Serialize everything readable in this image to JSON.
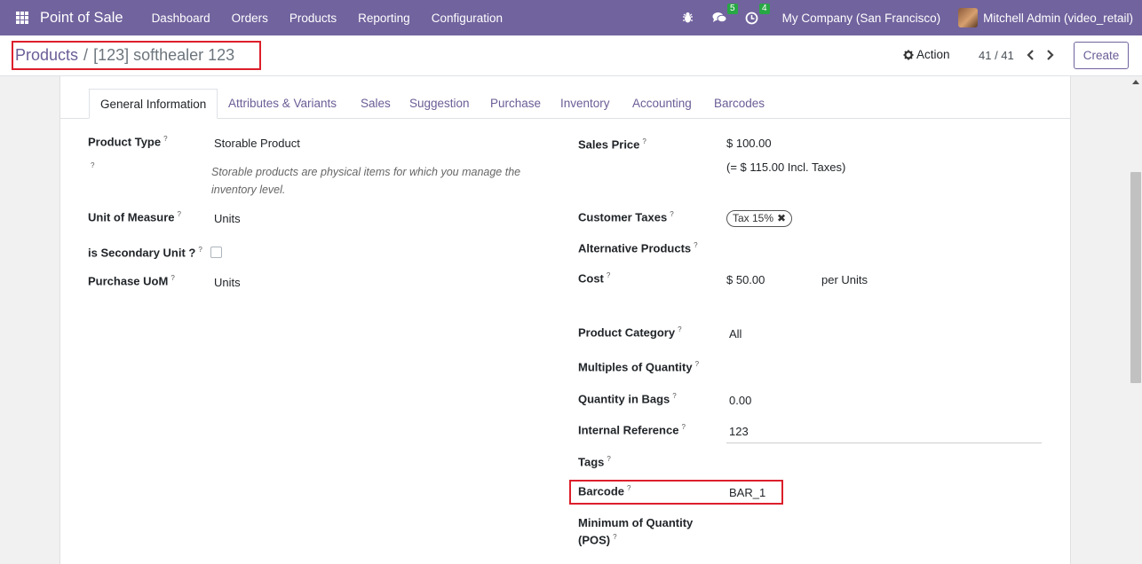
{
  "navbar": {
    "brand": "Point of Sale",
    "menu": [
      "Dashboard",
      "Orders",
      "Products",
      "Reporting",
      "Configuration"
    ],
    "messages_badge": "5",
    "activities_badge": "4",
    "company": "My Company (San Francisco)",
    "user": "Mitchell Admin (video_retail)"
  },
  "control": {
    "breadcrumb_parent": "Products",
    "breadcrumb_sep": "/",
    "breadcrumb_current": "[123] softhealer 123",
    "action_label": "Action",
    "pager": "41 / 41",
    "create_label": "Create"
  },
  "tabs": [
    "General Information",
    "Attributes & Variants",
    "Sales",
    "Suggestion",
    "Purchase",
    "Inventory",
    "Accounting",
    "Barcodes"
  ],
  "left": {
    "product_type_label": "Product Type",
    "product_type_value": "Storable Product",
    "product_type_help": "Storable products are physical items for which you manage the inventory level.",
    "uom_label": "Unit of Measure",
    "uom_value": "Units",
    "secondary_unit_label": "is Secondary Unit ?",
    "purchase_uom_label": "Purchase UoM",
    "purchase_uom_value": "Units"
  },
  "right": {
    "sales_price_label": "Sales Price",
    "sales_price_value": "$ 100.00",
    "sales_price_incl": "(= $ 115.00 Incl. Taxes)",
    "customer_taxes_label": "Customer Taxes",
    "customer_taxes_tag": "Tax 15%",
    "alt_products_label": "Alternative Products",
    "cost_label": "Cost",
    "cost_value": "$ 50.00",
    "cost_unit": "per Units",
    "category_label": "Product Category",
    "category_value": "All",
    "multiples_label": "Multiples of Quantity",
    "qty_bags_label": "Quantity in Bags",
    "qty_bags_value": "0.00",
    "internal_ref_label": "Internal Reference",
    "internal_ref_value": "123",
    "tags_label": "Tags",
    "barcode_label": "Barcode",
    "barcode_value": "BAR_1",
    "min_qty_label_1": "Minimum of Quantity",
    "min_qty_label_2": "(POS)"
  },
  "help_marker": "?",
  "colors": {
    "navbar": "#71639e",
    "accent_text": "#6b5d96",
    "highlight": "#dc1f2b",
    "badge": "#28a745"
  }
}
